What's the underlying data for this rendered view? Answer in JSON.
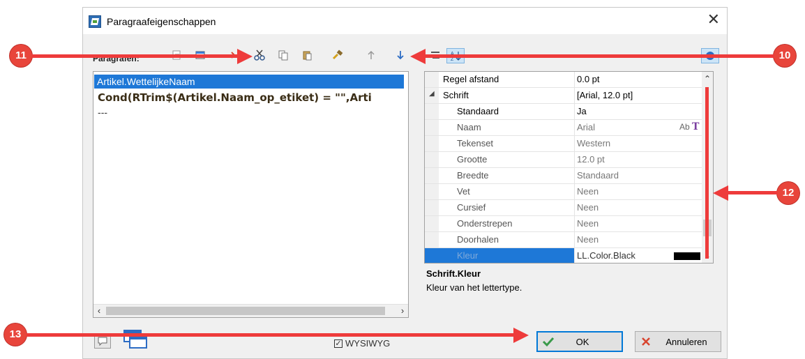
{
  "window": {
    "title": "Paragraafeigenschappen",
    "close_glyph": "✕"
  },
  "toolbar": {
    "label": "Paragrafen:",
    "icons": [
      "new-icon",
      "frame-icon",
      "arrow-icon",
      "cut-icon",
      "copy-icon",
      "paste-icon",
      "format-brush-icon",
      "move-up-icon",
      "move-down-icon",
      "categorized-icon",
      "sort-az-icon",
      "help-icon"
    ]
  },
  "editor": {
    "lines": [
      "Artikel.WettelijkeNaam",
      "Cond(RTrim$(Artikel.Naam_op_etiket) = \"\",Arti",
      "---"
    ]
  },
  "properties": {
    "rows": [
      {
        "name": "Regel afstand",
        "value": "0.0 pt"
      },
      {
        "name": "Schrift",
        "value": "[Arial, 12.0 pt]"
      },
      {
        "name": "Standaard",
        "value": "Ja"
      },
      {
        "name": "Naam",
        "value": "Arial",
        "extra": "Ab"
      },
      {
        "name": "Tekenset",
        "value": "Western"
      },
      {
        "name": "Grootte",
        "value": "12.0 pt"
      },
      {
        "name": "Breedte",
        "value": "Standaard"
      },
      {
        "name": "Vet",
        "value": "Neen"
      },
      {
        "name": "Cursief",
        "value": "Neen"
      },
      {
        "name": "Onderstrepen",
        "value": "Neen"
      },
      {
        "name": "Doorhalen",
        "value": "Neen"
      },
      {
        "name": "Kleur",
        "value": "LL.Color.Black",
        "swatch": "#000000"
      }
    ]
  },
  "description": {
    "title": "Schrift.Kleur",
    "text": "Kleur van het lettertype."
  },
  "footer": {
    "wysiwyg_label": "WYSIWYG",
    "ok_label": "OK",
    "cancel_label": "Annuleren"
  },
  "annotations": {
    "badge_10": "10",
    "badge_11": "11",
    "badge_12": "12",
    "badge_13": "13"
  },
  "colors": {
    "accent": "#1e78d7",
    "annotation": "#ee3b3b"
  }
}
